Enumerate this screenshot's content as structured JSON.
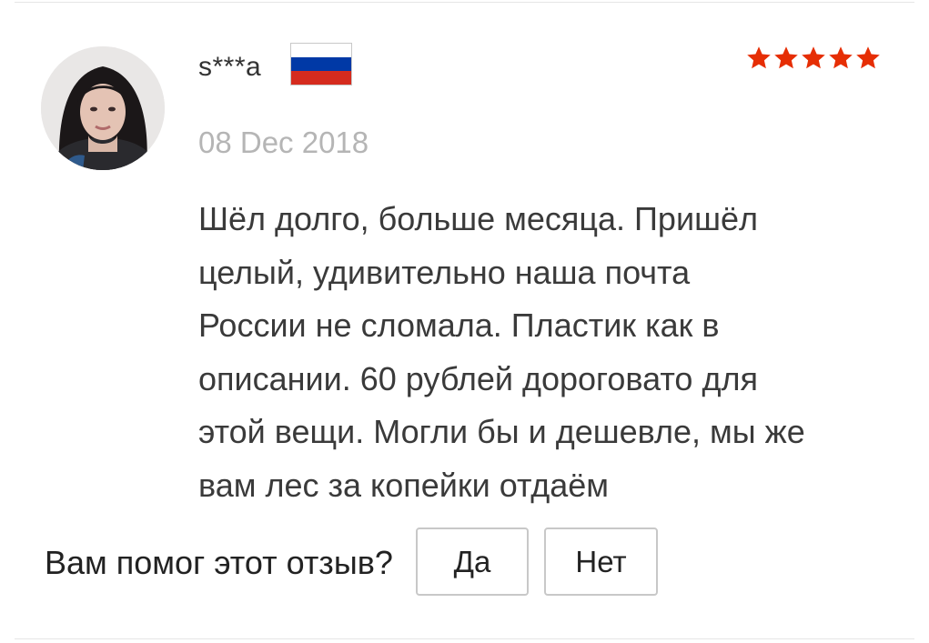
{
  "review": {
    "username": "s***a",
    "country_flag_icon": "russia-flag-icon",
    "flag_colors": [
      "#ffffff",
      "#0039a6",
      "#d52b1e"
    ],
    "rating": 5,
    "rating_max": 5,
    "star_color": "#e62e04",
    "date": "08 Dec 2018",
    "text": "Шёл долго, больше месяца. Пришёл\nцелый, удивительно   наша почта\nРоссии не сломала. Пластик как в\nописании. 60 рублей дороговато для\nэтой вещи. Могли бы и дешевле, мы же\nвам лес за копейки отдаём"
  },
  "feedback": {
    "question": "Вам помог этот отзыв?",
    "yes_label": "Да",
    "no_label": "Нет"
  }
}
